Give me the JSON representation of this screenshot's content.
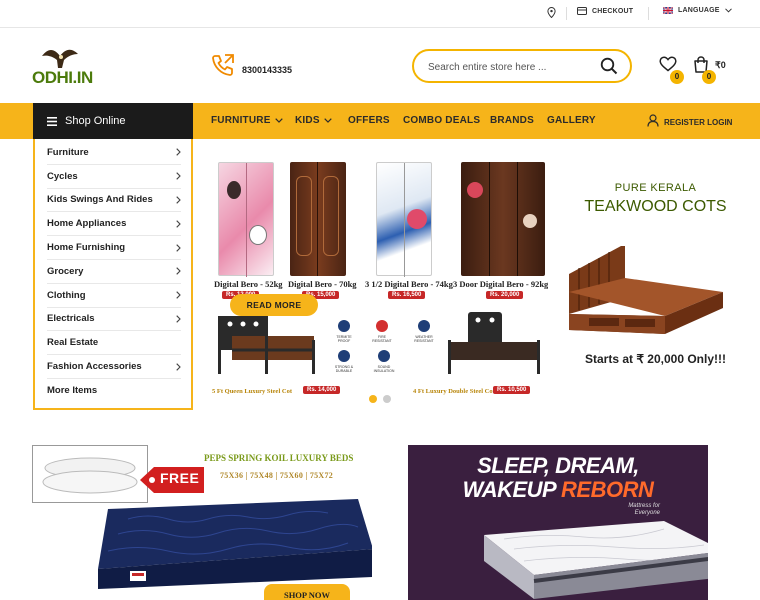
{
  "topbar": {
    "checkout": "CHECKOUT",
    "language": "LANGUAGE"
  },
  "header": {
    "logo_text": "ODHI.IN",
    "phone": "8300143335",
    "search_placeholder": "Search entire store here ...",
    "wishlist_count": "0",
    "cart_count": "0",
    "cart_total": "₹0"
  },
  "nav": {
    "shop_online": "Shop Online",
    "items": [
      "FURNITURE",
      "KIDS",
      "OFFERS",
      "COMBO DEALS",
      "BRANDS",
      "GALLERY"
    ],
    "register_login": "REGISTER LOGIN"
  },
  "sidebar": {
    "items": [
      {
        "label": "Furniture",
        "arrow": true
      },
      {
        "label": "Cycles",
        "arrow": true
      },
      {
        "label": "Kids Swings And Rides",
        "arrow": true
      },
      {
        "label": "Home Appliances",
        "arrow": true
      },
      {
        "label": "Home Furnishing",
        "arrow": true
      },
      {
        "label": "Grocery",
        "arrow": true
      },
      {
        "label": "Clothing",
        "arrow": true
      },
      {
        "label": "Electricals",
        "arrow": true
      },
      {
        "label": "Real Estate",
        "arrow": false
      },
      {
        "label": "Fashion Accessories",
        "arrow": true
      },
      {
        "label": "More Items",
        "arrow": false
      }
    ]
  },
  "slider": {
    "products": [
      {
        "caption": "Digital Bero - 52kg",
        "price": "Rs. 12,000"
      },
      {
        "caption": "Digital Bero - 70kg",
        "price": "Rs. 15,000"
      },
      {
        "caption": "3 1/2 Digital Bero - 74kg",
        "price": "Rs. 16,500"
      },
      {
        "caption": "3 Door Digital Bero - 92kg",
        "price": "Rs. 20,000"
      }
    ],
    "read_more": "READ MORE",
    "cots": [
      {
        "caption": "5 Ft Queen Luxury Steel Cot",
        "price": "Rs. 14,000"
      },
      {
        "caption": "4 Ft Luxury Double Steel Cot",
        "price": "Rs. 10,500"
      }
    ],
    "features": [
      "TERMITE PROOF",
      "FIRE RESISTANT",
      "WEATHER RESISTANT",
      "STRONG & DURABLE",
      "SOUND INSULATION"
    ]
  },
  "promo_right": {
    "line1": "PURE KERALA",
    "line2": "TEAKWOOD COTS",
    "line3": "Starts at ₹ 20,000 Only!!!"
  },
  "banner_left": {
    "title": "PEPS SPRING KOIL LUXURY BEDS",
    "sizes": "75X36 | 75X48 | 75X60 | 75X72",
    "free": "FREE",
    "shop_now": "SHOP NOW"
  },
  "banner_right": {
    "line1": "SLEEP, DREAM,",
    "line2a": "WAKEUP",
    "line2b": "REBORN",
    "tagline": "Mattress for Everyone"
  },
  "colors": {
    "accent": "#f6b41a",
    "dark": "#1b1b1b",
    "logo_green": "#4c7b0c",
    "price_red": "#c62828",
    "banner_purple": "#3a1f3f"
  }
}
